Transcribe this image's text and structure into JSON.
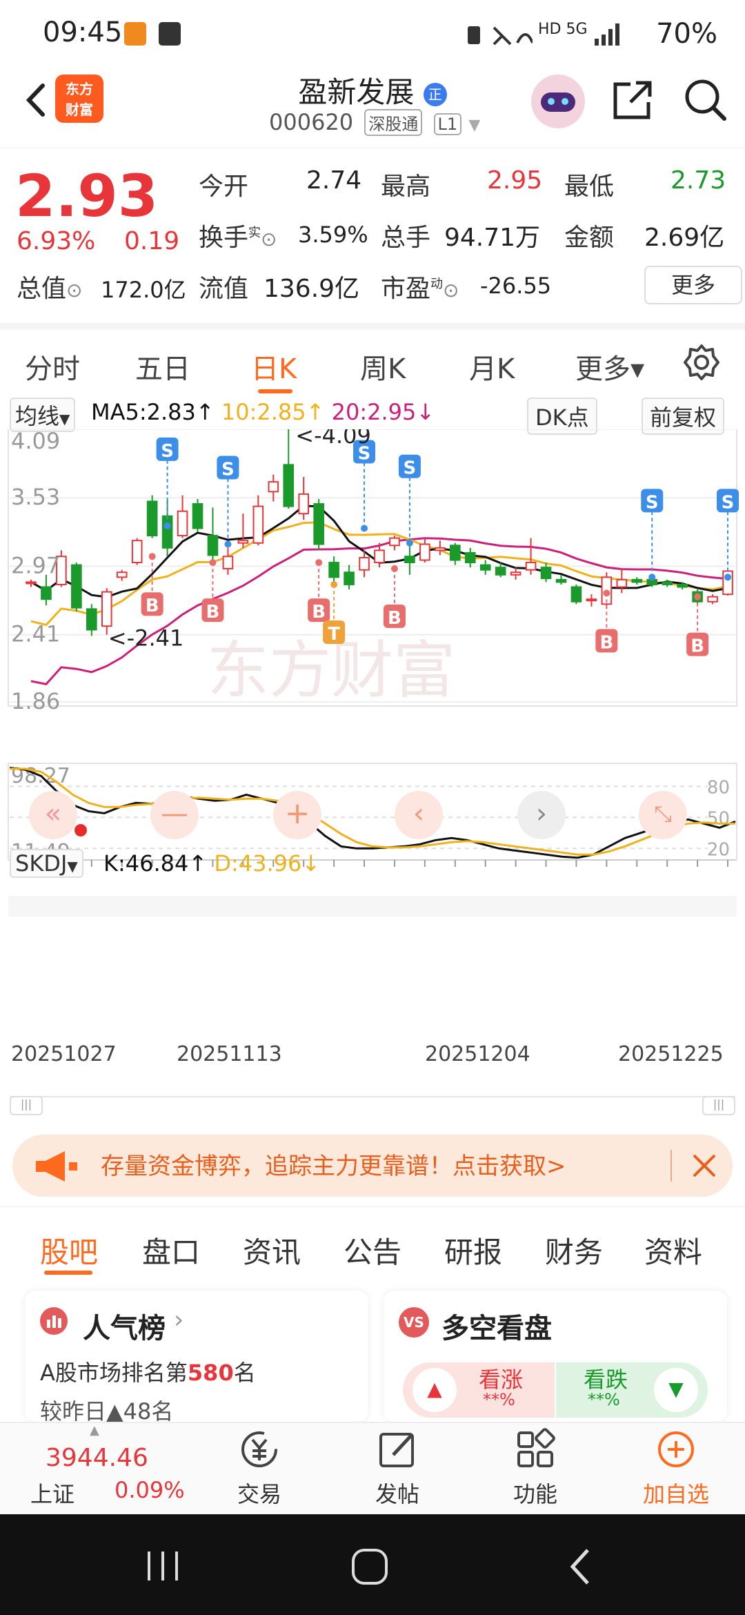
{
  "status_bar": {
    "time": "09:45",
    "network": "HD 5G",
    "battery": "70%"
  },
  "header": {
    "logo_line1": "东方",
    "logo_line2": "财富",
    "stock_name": "盈新发展",
    "name_badge": "正",
    "stock_code": "000620",
    "tag1": "深股通",
    "tag2": "L1"
  },
  "quote": {
    "price": "2.93",
    "change_pct": "6.93%",
    "change_amt": "0.19",
    "open_label": "今开",
    "open": "2.74",
    "high_label": "最高",
    "high": "2.95",
    "low_label": "最低",
    "low": "2.73",
    "turnover_label": "换手",
    "turnover_sup": "实",
    "turnover": "3.59%",
    "volume_label": "总手",
    "volume": "94.71万",
    "amount_label": "金额",
    "amount": "2.69亿",
    "mktcap_label": "总值",
    "mktcap": "172.0亿",
    "float_label": "流值",
    "float": "136.9亿",
    "pe_label": "市盈",
    "pe_sup": "动",
    "pe": "-26.55",
    "more": "更多"
  },
  "chart_tabs": [
    {
      "label": "分时"
    },
    {
      "label": "五日"
    },
    {
      "label": "日K"
    },
    {
      "label": "周K"
    },
    {
      "label": "月K"
    },
    {
      "label": "更多▾"
    }
  ],
  "chart_toolbar": {
    "ma_selector": "均线",
    "ma5": "MA5:2.83↑",
    "ma10": "10:2.85↑",
    "ma20": "20:2.95↓",
    "dk_button": "DK点",
    "adjust_button": "前复权"
  },
  "colors": {
    "up": "#e8353a",
    "down": "#1a9a2b",
    "ma5": "#111111",
    "ma10": "#f0b21c",
    "ma20": "#cc1f7a",
    "accent": "#ff6a1f"
  },
  "chart_data": [
    {
      "type": "candlestick",
      "y_ticks": [
        "4.09",
        "3.53",
        "2.97",
        "2.41",
        "1.86"
      ],
      "ylim": [
        1.86,
        4.09
      ],
      "annotations": [
        "<-4.09",
        "<-2.41"
      ],
      "marker_labels": [
        "S",
        "B",
        "T"
      ],
      "x_tick_labels": [
        "20251027",
        "20251113",
        "20251204",
        "20251225"
      ],
      "candles": [
        {
          "o": 2.84,
          "c": 2.84,
          "h": 2.86,
          "l": 2.8
        },
        {
          "o": 2.8,
          "c": 2.7,
          "h": 2.9,
          "l": 2.65
        },
        {
          "o": 2.82,
          "c": 3.05,
          "h": 3.1,
          "l": 2.8
        },
        {
          "o": 2.98,
          "c": 2.63,
          "h": 3.0,
          "l": 2.6
        },
        {
          "o": 2.62,
          "c": 2.45,
          "h": 2.66,
          "l": 2.4
        },
        {
          "o": 2.48,
          "c": 2.76,
          "h": 2.79,
          "l": 2.41
        },
        {
          "o": 2.88,
          "c": 2.92,
          "h": 2.94,
          "l": 2.85
        },
        {
          "o": 3.0,
          "c": 3.18,
          "h": 3.2,
          "l": 2.98
        },
        {
          "o": 3.5,
          "c": 3.22,
          "h": 3.55,
          "l": 3.2
        },
        {
          "o": 3.38,
          "c": 3.12,
          "h": 3.52,
          "l": 3.05
        },
        {
          "o": 3.22,
          "c": 3.42,
          "h": 3.55,
          "l": 3.2
        },
        {
          "o": 3.48,
          "c": 3.28,
          "h": 3.52,
          "l": 3.25
        },
        {
          "o": 3.22,
          "c": 3.06,
          "h": 3.45,
          "l": 3.0
        },
        {
          "o": 2.95,
          "c": 3.05,
          "h": 3.12,
          "l": 2.9
        },
        {
          "o": 3.16,
          "c": 3.18,
          "h": 3.4,
          "l": 3.12
        },
        {
          "o": 3.16,
          "c": 3.46,
          "h": 3.55,
          "l": 3.14
        },
        {
          "o": 3.58,
          "c": 3.66,
          "h": 3.72,
          "l": 3.5
        },
        {
          "o": 3.8,
          "c": 3.46,
          "h": 4.09,
          "l": 3.44
        },
        {
          "o": 3.4,
          "c": 3.56,
          "h": 3.7,
          "l": 3.35
        },
        {
          "o": 3.48,
          "c": 3.15,
          "h": 3.52,
          "l": 3.1
        },
        {
          "o": 3.0,
          "c": 2.88,
          "h": 3.05,
          "l": 2.8
        },
        {
          "o": 2.92,
          "c": 2.82,
          "h": 2.98,
          "l": 2.78
        },
        {
          "o": 2.94,
          "c": 3.04,
          "h": 3.1,
          "l": 2.88
        },
        {
          "o": 3.0,
          "c": 3.1,
          "h": 3.16,
          "l": 2.96
        },
        {
          "o": 3.14,
          "c": 3.2,
          "h": 3.22,
          "l": 3.1
        },
        {
          "o": 3.05,
          "c": 3.0,
          "h": 3.2,
          "l": 2.9
        },
        {
          "o": 3.02,
          "c": 3.15,
          "h": 3.2,
          "l": 3.0
        },
        {
          "o": 3.1,
          "c": 3.12,
          "h": 3.18,
          "l": 3.06
        },
        {
          "o": 3.14,
          "c": 3.02,
          "h": 3.16,
          "l": 2.98
        },
        {
          "o": 3.08,
          "c": 3.0,
          "h": 3.12,
          "l": 2.96
        },
        {
          "o": 2.98,
          "c": 2.94,
          "h": 3.02,
          "l": 2.9
        },
        {
          "o": 2.96,
          "c": 2.9,
          "h": 3.0,
          "l": 2.88
        },
        {
          "o": 2.9,
          "c": 2.92,
          "h": 2.96,
          "l": 2.86
        },
        {
          "o": 2.94,
          "c": 3.0,
          "h": 3.2,
          "l": 2.9
        },
        {
          "o": 2.96,
          "c": 2.87,
          "h": 3.0,
          "l": 2.84
        },
        {
          "o": 2.86,
          "c": 2.84,
          "h": 2.9,
          "l": 2.82
        },
        {
          "o": 2.8,
          "c": 2.68,
          "h": 2.82,
          "l": 2.66
        },
        {
          "o": 2.7,
          "c": 2.7,
          "h": 2.74,
          "l": 2.64
        },
        {
          "o": 2.66,
          "c": 2.88,
          "h": 2.92,
          "l": 2.62
        },
        {
          "o": 2.8,
          "c": 2.86,
          "h": 2.95,
          "l": 2.75
        },
        {
          "o": 2.86,
          "c": 2.84,
          "h": 2.88,
          "l": 2.82
        },
        {
          "o": 2.86,
          "c": 2.82,
          "h": 2.88,
          "l": 2.8
        },
        {
          "o": 2.84,
          "c": 2.82,
          "h": 2.86,
          "l": 2.8
        },
        {
          "o": 2.82,
          "c": 2.8,
          "h": 2.84,
          "l": 2.78
        },
        {
          "o": 2.76,
          "c": 2.68,
          "h": 2.78,
          "l": 2.66
        },
        {
          "o": 2.68,
          "c": 2.72,
          "h": 2.74,
          "l": 2.66
        },
        {
          "o": 2.74,
          "c": 2.93,
          "h": 2.95,
          "l": 2.73
        }
      ]
    },
    {
      "type": "line",
      "indicator": "SKDJ",
      "k_label": "K:46.84↑",
      "d_label": "D:43.96↓",
      "y_ticks_left": [
        "98.27",
        "11.49"
      ],
      "y_ticks_right": [
        "80",
        "50",
        "20"
      ],
      "ylim": [
        11.49,
        98.27
      ],
      "series": [
        {
          "name": "K",
          "values": [
            98,
            96,
            90,
            75,
            62,
            56,
            54,
            60,
            64,
            63,
            68,
            70,
            68,
            66,
            67,
            72,
            68,
            64,
            58,
            45,
            32,
            22,
            20,
            20,
            21,
            22,
            24,
            28,
            30,
            28,
            24,
            20,
            18,
            16,
            14,
            12,
            11,
            14,
            22,
            30,
            35,
            40,
            44,
            48,
            44,
            40,
            46
          ]
        },
        {
          "name": "D",
          "values": [
            97,
            97,
            94,
            84,
            72,
            64,
            60,
            60,
            62,
            63,
            66,
            68,
            69,
            68,
            67,
            68,
            68,
            66,
            62,
            54,
            44,
            34,
            26,
            22,
            21,
            21,
            22,
            24,
            26,
            27,
            26,
            24,
            22,
            20,
            18,
            16,
            14,
            14,
            17,
            22,
            28,
            34,
            40,
            44,
            45,
            44,
            44
          ]
        }
      ]
    }
  ],
  "chart_controls": {
    "zoom_out": "—",
    "zoom_in": "+"
  },
  "banner": {
    "text": "存量资金博弈，追踪主力更靠谱！点击获取>"
  },
  "sub_tabs": [
    {
      "label": "股吧"
    },
    {
      "label": "盘口"
    },
    {
      "label": "资讯"
    },
    {
      "label": "公告"
    },
    {
      "label": "研报"
    },
    {
      "label": "财务"
    },
    {
      "label": "资料"
    }
  ],
  "cards": {
    "popularity": {
      "title": "人气榜",
      "rank_prefix": "A股市场排名第",
      "rank": "580",
      "rank_suffix": "名",
      "sub": "较昨日▲48名"
    },
    "sentiment": {
      "title": "多空看盘",
      "bull": "看涨",
      "bull_pct": "**%",
      "bear": "看跌",
      "bear_pct": "**%"
    }
  },
  "bottom_nav": {
    "index_value": "3944.46",
    "index_name": "上证",
    "index_change": "0.09%",
    "items": [
      {
        "label": "交易"
      },
      {
        "label": "发帖"
      },
      {
        "label": "功能"
      },
      {
        "label": "加自选"
      }
    ]
  }
}
